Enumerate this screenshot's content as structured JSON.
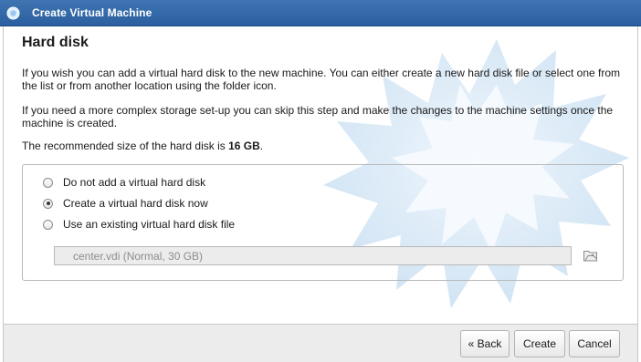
{
  "window": {
    "title": "Create Virtual Machine"
  },
  "page": {
    "heading": "Hard disk",
    "paragraph1_line1": "If you wish you can add a virtual hard disk to the new machine. You can either create a new hard disk file or select one from",
    "paragraph1_line2": "the list or from another location using the folder icon.",
    "paragraph2_line1": "If you need a more complex storage set-up you can skip this step and make the changes to the machine settings once the",
    "paragraph2_line2": "machine is created.",
    "recommended_prefix": "The recommended size of the hard disk is ",
    "recommended_size": "16 GB",
    "recommended_suffix": "."
  },
  "options": [
    {
      "label": "Do not add a virtual hard disk",
      "checked": false
    },
    {
      "label": "Create a virtual hard disk now",
      "checked": true
    },
    {
      "label": "Use an existing virtual hard disk file",
      "checked": false
    }
  ],
  "disk_select": {
    "value": "center.vdi (Normal, 30 GB)",
    "enabled": false
  },
  "buttons": {
    "back": "« Back",
    "create": "Create",
    "cancel": "Cancel"
  },
  "icons": {
    "app": "virtualbox-icon",
    "folder": "folder-icon"
  },
  "colors": {
    "titlebar": "#2f66a8",
    "bottombar": "#ececec"
  }
}
